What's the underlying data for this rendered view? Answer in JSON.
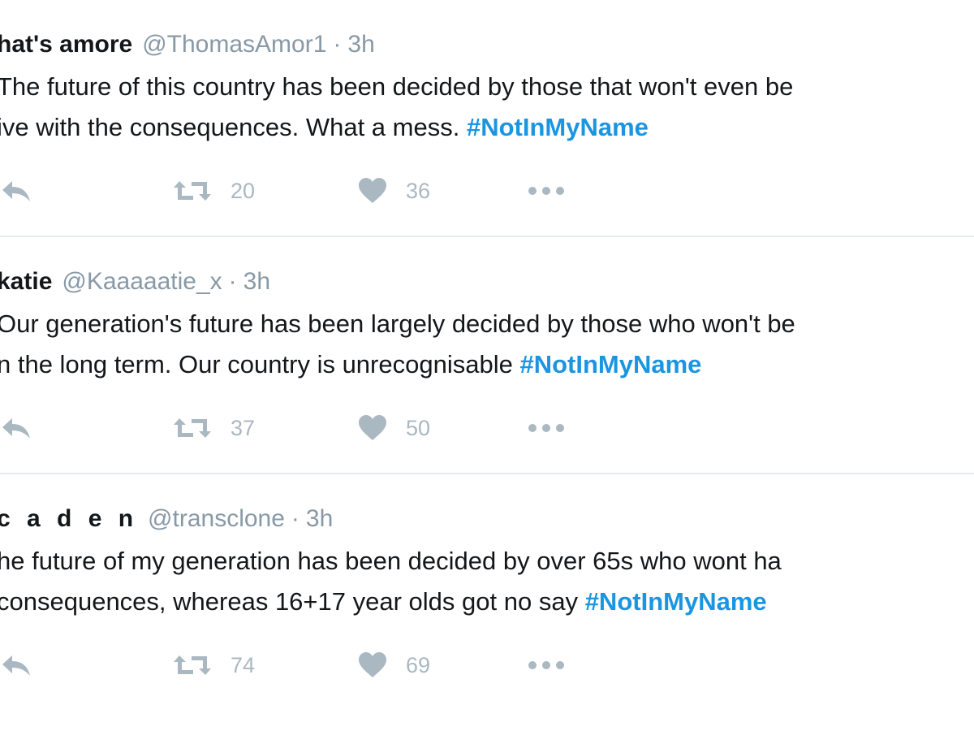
{
  "tweets": [
    {
      "name": "hat's amore",
      "handle": "@ThomasAmor1",
      "separator": "·",
      "time": "3h",
      "text_lines": [
        "The future of this country has been decided by those that won't even be",
        "ive with the consequences. What a mess."
      ],
      "hashtag": "#NotInMyName",
      "retweets": "20",
      "likes": "36"
    },
    {
      "name": "katie",
      "handle": "@Kaaaaatie_x",
      "separator": "·",
      "time": "3h",
      "text_lines": [
        "Our generation's future has been largely decided by those who won't be",
        "n the long term. Our country is unrecognisable"
      ],
      "hashtag": "#NotInMyName",
      "retweets": "37",
      "likes": "50"
    },
    {
      "name": "c a d e n",
      "handle": "@transclone",
      "separator": "·",
      "time": "3h",
      "text_lines": [
        "he future of my generation has been decided by over 65s who wont ha",
        "consequences, whereas 16+17 year olds got no say"
      ],
      "hashtag": "#NotInMyName",
      "retweets": "74",
      "likes": "69"
    }
  ],
  "icons": {
    "reply": "reply-arrow",
    "retweet": "retweet-arrows",
    "like": "heart",
    "more": "three-dots"
  },
  "colors": {
    "text": "#14171a",
    "muted": "#8899a6",
    "icon": "#aab8c2",
    "hashtag": "#1b95e0",
    "divider": "#e6ecf0"
  }
}
